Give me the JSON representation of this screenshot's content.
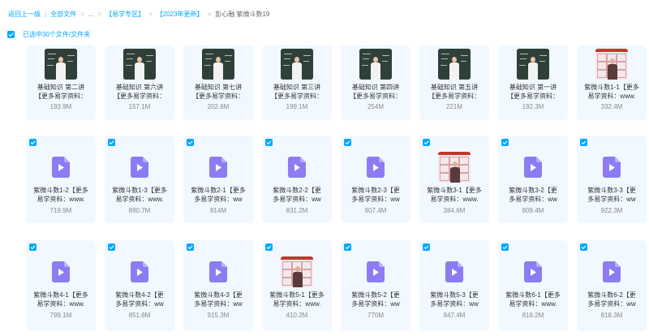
{
  "breadcrumb": {
    "back": "返回上一级",
    "items": [
      "全部文件",
      "...",
      "【易学专区】",
      "【2023年更新】"
    ],
    "current": "彭心融 紫微斗数19"
  },
  "selection": {
    "text": "已选中30个文件/文件夹"
  },
  "icons": {
    "checkbox": "checkbox-checked-icon",
    "video": "video-file-icon"
  },
  "colors": {
    "accent": "#06a7ff",
    "card_bg": "#f1f8ff",
    "video_icon": "#8c7bf2"
  },
  "rows": [
    [
      {
        "thumb": "board",
        "name": [
          "基础知识 第二讲",
          "【更多易学资料："
        ],
        "size": "193.9M"
      },
      {
        "thumb": "board",
        "name": [
          "基础知识 第六讲",
          "【更多易学资料："
        ],
        "size": "157.1M"
      },
      {
        "thumb": "board",
        "name": [
          "基础知识 第七讲",
          "【更多易学资料："
        ],
        "size": "202.6M"
      },
      {
        "thumb": "board",
        "name": [
          "基础知识 第三讲",
          "【更多易学资料："
        ],
        "size": "199.1M"
      },
      {
        "thumb": "board",
        "name": [
          "基础知识 第四讲",
          "【更多易学资料："
        ],
        "size": "254M"
      },
      {
        "thumb": "board",
        "name": [
          "基础知识 第五讲",
          "【更多易学资料："
        ],
        "size": "221M"
      },
      {
        "thumb": "board",
        "name": [
          "基础知识 第一讲",
          "【更多易学资料："
        ],
        "size": "192.3M"
      },
      {
        "thumb": "chart",
        "name": [
          "紫微斗数1-1【更多",
          "易学资料：www."
        ],
        "size": "332.4M"
      }
    ],
    [
      {
        "thumb": "video",
        "name": [
          "紫微斗数1-2【更多",
          "易学资料：www."
        ],
        "size": "719.9M"
      },
      {
        "thumb": "video",
        "name": [
          "紫微斗数1-3【更多",
          "易学资料：www."
        ],
        "size": "890.7M"
      },
      {
        "thumb": "video",
        "name": [
          "紫微斗数2-1【更多",
          "多易学资料：ww"
        ],
        "size": "814M"
      },
      {
        "thumb": "video",
        "name": [
          "紫微斗数2-2【更",
          "多易学资料：ww"
        ],
        "size": "831.2M"
      },
      {
        "thumb": "video",
        "name": [
          "紫微斗数2-3【更",
          "多易学资料：ww"
        ],
        "size": "907.4M"
      },
      {
        "thumb": "chart",
        "name": [
          "紫微斗数3-1【更多",
          "易学资料：www."
        ],
        "size": "384.6M"
      },
      {
        "thumb": "video",
        "name": [
          "紫微斗数3-2【更",
          "多易学资料：ww"
        ],
        "size": "809.4M"
      },
      {
        "thumb": "video",
        "name": [
          "紫微斗数3-3【更",
          "多易学资料：ww"
        ],
        "size": "922.3M"
      }
    ],
    [
      {
        "thumb": "video",
        "name": [
          "紫微斗数4-1【更多",
          "易学资料：www."
        ],
        "size": "799.1M"
      },
      {
        "thumb": "video",
        "name": [
          "紫微斗数4-2【更",
          "多易学资料：ww"
        ],
        "size": "851.6M"
      },
      {
        "thumb": "video",
        "name": [
          "紫微斗数4-3【更",
          "多易学资料：ww"
        ],
        "size": "915.3M"
      },
      {
        "thumb": "chart",
        "name": [
          "紫微斗数5-1【更多",
          "易学资料：www."
        ],
        "size": "410.2M"
      },
      {
        "thumb": "video",
        "name": [
          "紫微斗数5-2【更",
          "多易学资料：ww"
        ],
        "size": "770M"
      },
      {
        "thumb": "video",
        "name": [
          "紫微斗数5-3【更",
          "多易学资料：ww"
        ],
        "size": "847.4M"
      },
      {
        "thumb": "video",
        "name": [
          "紫微斗数6-1【更多",
          "易学资料：www."
        ],
        "size": "816.2M"
      },
      {
        "thumb": "video",
        "name": [
          "紫微斗数6-2【更",
          "多易学资料：ww"
        ],
        "size": "818.3M"
      }
    ]
  ]
}
